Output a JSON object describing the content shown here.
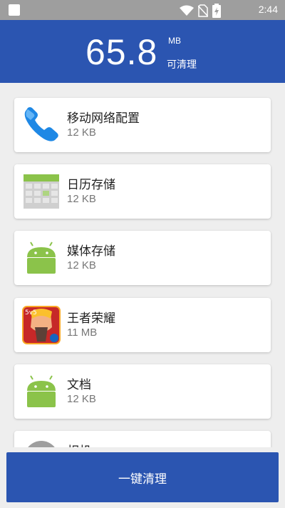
{
  "status_bar": {
    "time": "2:44",
    "icons": [
      "wifi-icon",
      "no-sim-icon",
      "battery-charging-icon"
    ]
  },
  "header": {
    "amount": "65.8",
    "unit": "MB",
    "cleanable_label": "可清理"
  },
  "items": [
    {
      "name": "移动网络配置",
      "size": "12 KB",
      "icon": "phone-icon"
    },
    {
      "name": "日历存储",
      "size": "12 KB",
      "icon": "calendar-icon"
    },
    {
      "name": "媒体存储",
      "size": "12 KB",
      "icon": "android-icon"
    },
    {
      "name": "王者荣耀",
      "size": "11 MB",
      "icon": "game-icon"
    },
    {
      "name": "文档",
      "size": "12 KB",
      "icon": "android-icon"
    },
    {
      "name": "相机",
      "size": "",
      "icon": "camera-icon"
    }
  ],
  "actions": {
    "clean_button": "一键清理"
  },
  "colors": {
    "accent": "#2b55b1",
    "status_bar": "#9e9e9e",
    "background": "#eeeeee"
  }
}
